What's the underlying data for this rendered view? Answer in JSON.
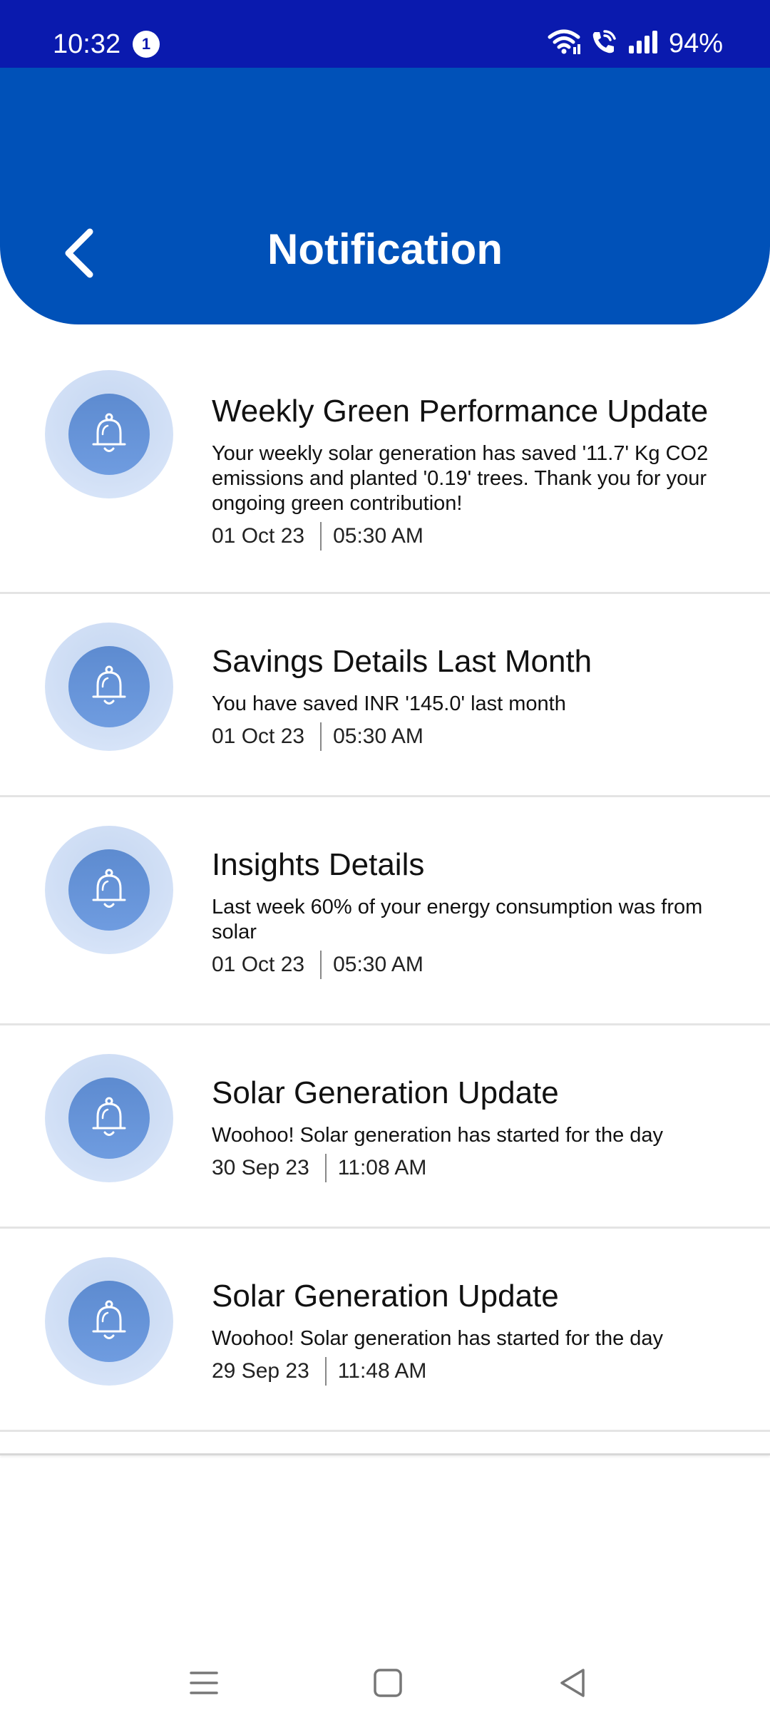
{
  "status_bar": {
    "time": "10:32",
    "notification_count": "1",
    "battery": "94%"
  },
  "header": {
    "title": "Notification"
  },
  "notifications": [
    {
      "title": "Weekly Green Performance Update",
      "body": "Your weekly solar generation has saved '11.7' Kg CO2 emissions and planted '0.19' trees. Thank you for your ongoing green contribution!",
      "date": "01 Oct 23",
      "time": "05:30 AM"
    },
    {
      "title": "Savings Details Last Month",
      "body": "You have saved INR '145.0' last month",
      "date": "01 Oct 23",
      "time": "05:30 AM"
    },
    {
      "title": "Insights Details",
      "body": "Last week 60% of your energy consumption was from solar",
      "date": "01 Oct 23",
      "time": "05:30 AM"
    },
    {
      "title": "Solar Generation Update",
      "body": "Woohoo! Solar generation has started for the day",
      "date": "30 Sep 23",
      "time": "11:08 AM"
    },
    {
      "title": "Solar Generation Update",
      "body": "Woohoo! Solar generation has started for the day",
      "date": "29 Sep 23",
      "time": "11:48 AM"
    }
  ],
  "colors": {
    "status_bar_bg": "#0a1aae",
    "header_bg": "#0051b8",
    "icon_inner": "#6a97d9",
    "icon_outer": "#d0def5"
  },
  "icons": {
    "back": "chevron-left-icon",
    "notification": "bell-icon",
    "nav_recents": "menu-icon",
    "nav_home": "square-icon",
    "nav_back": "triangle-back-icon"
  }
}
